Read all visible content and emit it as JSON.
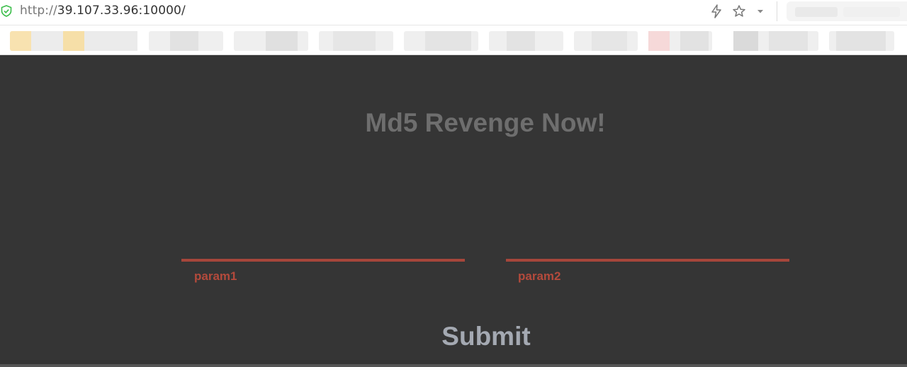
{
  "browser": {
    "url_protocol": "http://",
    "url_host": "39.107.33.96:10000/",
    "icons": [
      "shield-check-icon",
      "bolt-icon",
      "star-icon",
      "chevron-down-icon"
    ]
  },
  "colors": {
    "page_bg": "#353535",
    "title": "#6e6e6e",
    "accent": "#b44a3c",
    "submit": "#a4a9b2"
  },
  "page": {
    "title": "Md5 Revenge Now!",
    "fields": [
      {
        "label": "param1",
        "value": ""
      },
      {
        "label": "param2",
        "value": ""
      }
    ],
    "submit_label": "Submit"
  }
}
